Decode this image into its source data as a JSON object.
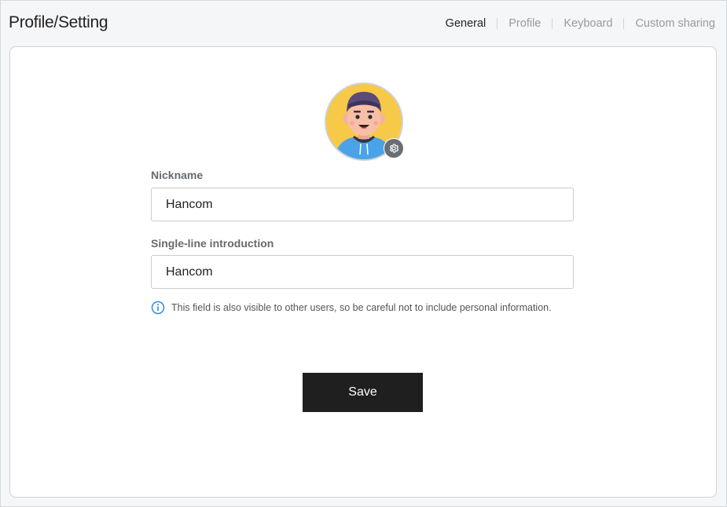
{
  "header": {
    "title": "Profile/Setting",
    "tabs": [
      {
        "label": "General",
        "active": true
      },
      {
        "label": "Profile",
        "active": false
      },
      {
        "label": "Keyboard",
        "active": false
      },
      {
        "label": "Custom sharing",
        "active": false
      }
    ]
  },
  "profile": {
    "avatar_icon": "user-avatar",
    "settings_icon": "gear-icon",
    "nickname_label": "Nickname",
    "nickname_value": "Hancom",
    "intro_label": "Single-line introduction",
    "intro_value": "Hancom",
    "notice_icon": "info-icon",
    "notice_text": "This field is also visible to other users, so be careful not to include personal information.",
    "save_label": "Save"
  },
  "colors": {
    "accent_info": "#2f8fd8",
    "save_bg": "#1f1f1f",
    "avatar_bg": "#f7c948"
  }
}
